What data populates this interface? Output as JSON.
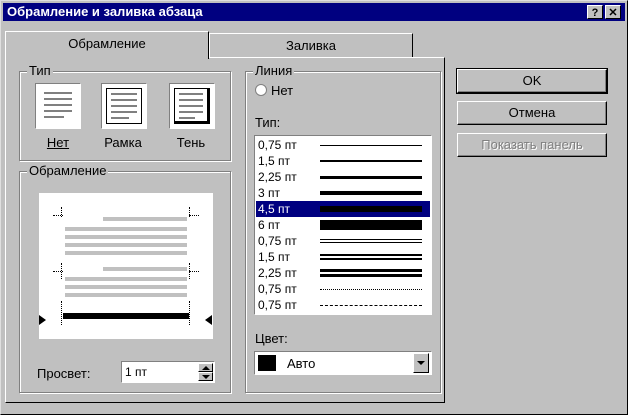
{
  "window": {
    "title": "Обрамление и заливка абзаца",
    "help_glyph": "?",
    "close_glyph": "✕"
  },
  "tabs": [
    {
      "label": "Обрамление",
      "active": true
    },
    {
      "label": "Заливка",
      "active": false
    }
  ],
  "type_group": {
    "label": "Тип",
    "options": [
      {
        "label": "Нет"
      },
      {
        "label": "Рамка"
      },
      {
        "label": "Тень"
      }
    ]
  },
  "border_group": {
    "label": "Обрамление",
    "spacing_label": "Просвет:",
    "spacing_value": "1 пт"
  },
  "line_group": {
    "label": "Линия",
    "none_label": "Нет",
    "type_label": "Тип:",
    "styles": [
      {
        "label": "0,75 пт",
        "style": "single",
        "weight": 1
      },
      {
        "label": "1,5 пт",
        "style": "single",
        "weight": 2
      },
      {
        "label": "2,25 пт",
        "style": "single",
        "weight": 3
      },
      {
        "label": "3 пт",
        "style": "single",
        "weight": 4
      },
      {
        "label": "4,5 пт",
        "style": "single",
        "weight": 6,
        "selected": true
      },
      {
        "label": "6 пт",
        "style": "single",
        "weight": 10
      },
      {
        "label": "0,75 пт",
        "style": "double",
        "weight": 1
      },
      {
        "label": "1,5 пт",
        "style": "double",
        "weight": 2
      },
      {
        "label": "2,25 пт",
        "style": "double",
        "weight": 3
      },
      {
        "label": "0,75 пт",
        "style": "dotted",
        "weight": 1
      },
      {
        "label": "0,75 пт",
        "style": "dashed",
        "weight": 1
      }
    ],
    "color_label": "Цвет:",
    "color_value": "Авто",
    "color_swatch": "#000000"
  },
  "buttons": {
    "ok": "OK",
    "cancel": "Отмена",
    "show_toolbar": "Показать панель"
  },
  "colors": {
    "titlebar": "#000080",
    "face": "#c0c0c0",
    "selection": "#000080"
  }
}
